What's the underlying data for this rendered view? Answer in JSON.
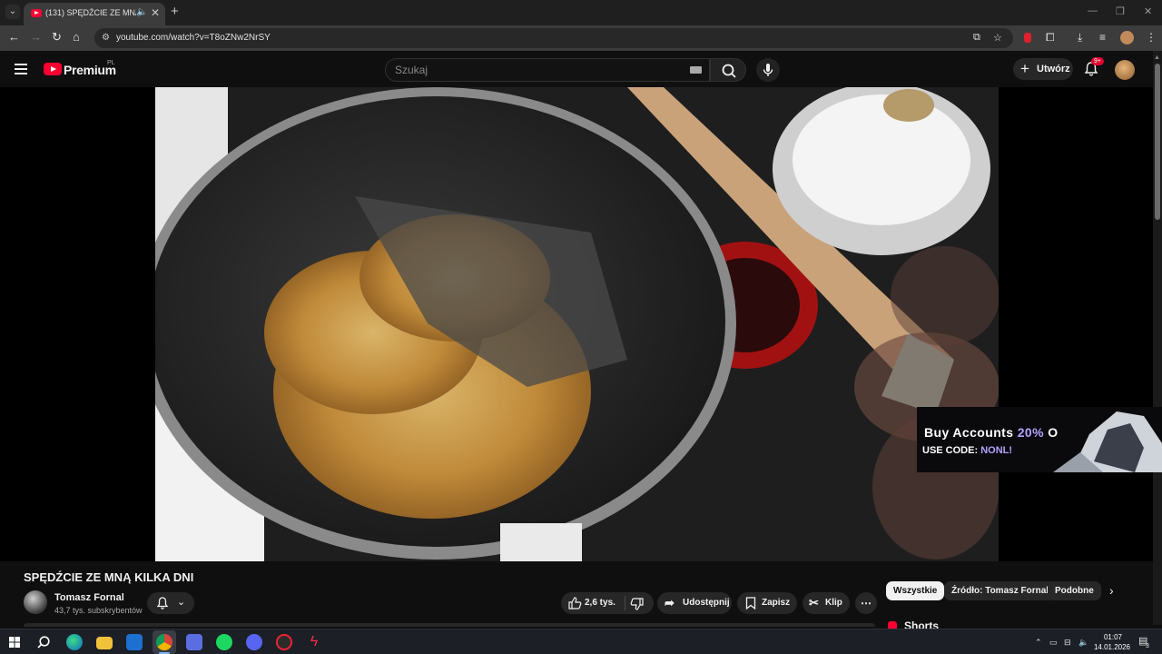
{
  "browser": {
    "tab_title": "(131) SPĘDŹCIE ZE MNĄ KI...",
    "tab_close": "✕",
    "new_tab": "+",
    "url": "youtube.com/watch?v=T8oZNw2NrSY",
    "window_controls": [
      "—",
      "❐",
      "✕"
    ]
  },
  "masthead": {
    "logo_text": "Premium",
    "logo_country": "PL",
    "search_placeholder": "Szukaj",
    "create_label": "Utwórz",
    "notifications_badge": "9+"
  },
  "ad_overlay": {
    "line1_prefix": "Buy Accounts ",
    "line1_accent": "20%",
    "line1_suffix": " O",
    "line2_prefix": "USE CODE: ",
    "line2_accent": "NONL!"
  },
  "video": {
    "title": "SPĘDŹCIE ZE MNĄ KILKA DNI",
    "channel_name": "Tomasz Fornal",
    "channel_subs": "43,7 tys. subskrybentów",
    "likes": "2,6 tys.",
    "share_label": "Udostępnij",
    "save_label": "Zapisz",
    "clip_label": "Klip",
    "more_label": "⋯"
  },
  "chips": [
    "Wszystkie",
    "Źródło: Tomasz Fornal",
    "Podobne"
  ],
  "shorts_label": "Shorts",
  "taskbar": {
    "time": "01:07",
    "date": "14.01.2026",
    "notification_count": "3"
  },
  "colors": {
    "youtube_red": "#ff0033",
    "ad_accent": "#b5a1ff",
    "page_bg": "#0f0f0f"
  }
}
